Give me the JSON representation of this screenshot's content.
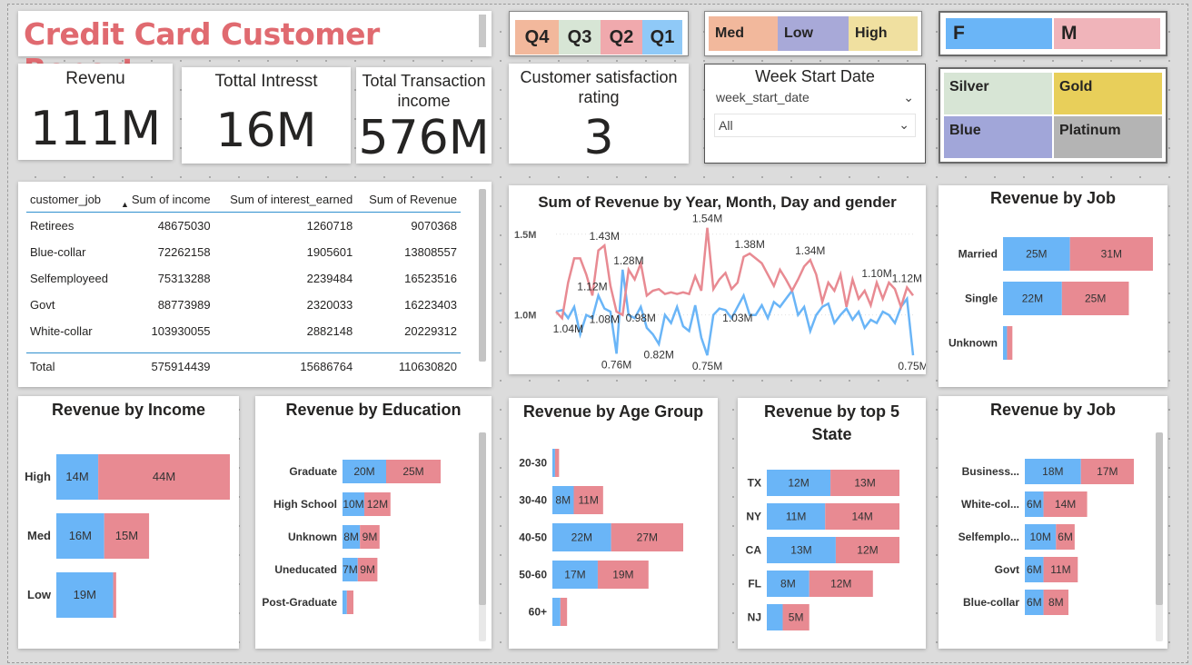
{
  "report": {
    "title": "Credit Card Customer Report"
  },
  "kpis": {
    "revenue": {
      "label": "Revenu",
      "value": "111M"
    },
    "interest": {
      "label": "Tottal Intresst",
      "value": "16M"
    },
    "transaction": {
      "label": "Total Transaction income",
      "value": "576M"
    },
    "satisfaction": {
      "label": "Customer satisfaction rating",
      "value": "3"
    }
  },
  "slicers": {
    "quarter": [
      {
        "label": "Q4",
        "color": "#f2b89c"
      },
      {
        "label": "Q3",
        "color": "#d7e5d5"
      },
      {
        "label": "Q2",
        "color": "#f0a9ad"
      },
      {
        "label": "Q1",
        "color": "#8fc9f7"
      }
    ],
    "risk": [
      {
        "label": "Med",
        "color": "#f2b89c"
      },
      {
        "label": "Low",
        "color": "#a8a9d8"
      },
      {
        "label": "High",
        "color": "#f0e0a0"
      }
    ],
    "gender": [
      {
        "label": "F",
        "color": "#6ab5f7"
      },
      {
        "label": "M",
        "color": "#f0b4ba"
      }
    ],
    "week": {
      "title": "Week Start Date",
      "field": "week_start_date",
      "selected": "All"
    },
    "card_category": [
      {
        "label": "Silver",
        "color": "#d7e5d5"
      },
      {
        "label": "Gold",
        "color": "#e8cf5a"
      },
      {
        "label": "Blue",
        "color": "#a1a6d9"
      },
      {
        "label": "Platinum",
        "color": "#b4b4b4"
      }
    ]
  },
  "matrix": {
    "columns": [
      "customer_job",
      "Sum of income",
      "Sum of interest_earned",
      "Sum of Revenue"
    ],
    "rows": [
      [
        "Retirees",
        "48675030",
        "1260718",
        "9070368"
      ],
      [
        "Blue-collar",
        "72262158",
        "1905601",
        "13808557"
      ],
      [
        "Selfemployeed",
        "75313288",
        "2239484",
        "16523516"
      ],
      [
        "Govt",
        "88773989",
        "2320033",
        "16223403"
      ],
      [
        "White-collar",
        "103930055",
        "2882148",
        "20229312"
      ]
    ],
    "total": [
      "Total",
      "575914439",
      "15686764",
      "110630820"
    ]
  },
  "colors": {
    "female": "#6ab5f7",
    "male": "#e88a92"
  },
  "charts": {
    "line": {
      "title": "Sum of Revenue by Year, Month, Day and gender",
      "yticks": [
        "1.5M",
        "1.0M"
      ]
    },
    "job_marital": {
      "title": "Revenue by Job"
    },
    "income": {
      "title": "Revenue by Income"
    },
    "education": {
      "title": "Revenue by Education"
    },
    "age": {
      "title": "Revenue by Age Group"
    },
    "state": {
      "title": "Revenue by top 5 State"
    },
    "job": {
      "title": "Revenue by Job"
    }
  },
  "chart_data": [
    {
      "type": "line",
      "title": "Sum of Revenue by Year, Month, Day and gender",
      "y_ticks": [
        1.0,
        1.5
      ],
      "ylim": [
        0.7,
        1.6
      ],
      "series": [
        {
          "name": "F",
          "values": [
            1.02,
            1.03,
            0.98,
            1.05,
            0.88,
            1.0,
            0.98,
            1.12,
            1.04,
            1.02,
            0.76,
            1.28,
            1.0,
            0.98,
            1.05,
            0.92,
            0.88,
            0.82,
            1.0,
            0.95,
            1.05,
            0.93,
            0.9,
            1.06,
            0.86,
            0.75,
            1.0,
            1.04,
            1.03,
            0.98,
            1.05,
            1.12,
            1.0,
            1.0,
            1.06,
            0.98,
            1.08,
            1.05,
            1.1,
            1.15,
            1.0,
            1.05,
            0.9,
            1.0,
            1.05,
            1.07,
            0.95,
            1.0,
            1.04,
            0.97,
            1.02,
            0.92,
            0.97,
            0.95,
            1.02,
            1.0,
            0.95,
            1.05,
            1.1,
            0.75
          ],
          "labels": [
            {
              "i": 2,
              "t": "1.04M"
            },
            {
              "i": 8,
              "t": "1.08M"
            },
            {
              "i": 10,
              "t": "0.76M"
            },
            {
              "i": 14,
              "t": "0.98M"
            },
            {
              "i": 17,
              "t": "0.82M"
            },
            {
              "i": 25,
              "t": "0.75M"
            },
            {
              "i": 30,
              "t": "1.03M"
            },
            {
              "i": 59,
              "t": "0.75M"
            }
          ]
        },
        {
          "name": "M",
          "values": [
            1.02,
            0.98,
            1.2,
            1.35,
            1.35,
            1.25,
            1.12,
            1.4,
            1.43,
            1.18,
            1.02,
            1.0,
            1.28,
            1.22,
            1.32,
            1.12,
            1.15,
            1.16,
            1.13,
            1.14,
            1.13,
            1.14,
            1.13,
            1.24,
            1.15,
            1.54,
            1.16,
            1.22,
            1.26,
            1.16,
            1.2,
            1.36,
            1.38,
            1.35,
            1.32,
            1.25,
            1.18,
            1.28,
            1.22,
            1.15,
            1.22,
            1.3,
            1.34,
            1.25,
            1.08,
            1.2,
            1.15,
            1.25,
            1.05,
            1.22,
            1.1,
            1.15,
            1.06,
            1.2,
            1.1,
            1.2,
            1.16,
            1.05,
            1.17,
            1.12
          ],
          "labels": [
            {
              "i": 6,
              "t": "1.12M"
            },
            {
              "i": 8,
              "t": "1.43M"
            },
            {
              "i": 12,
              "t": "1.28M"
            },
            {
              "i": 25,
              "t": "1.54M"
            },
            {
              "i": 32,
              "t": "1.38M"
            },
            {
              "i": 42,
              "t": "1.34M"
            },
            {
              "i": 53,
              "t": "1.10M"
            },
            {
              "i": 58,
              "t": "1.12M"
            }
          ]
        }
      ]
    },
    {
      "type": "bar",
      "title": "Revenue by Job",
      "orientation": "horizontal",
      "stacked": true,
      "categories": [
        "Married",
        "Single",
        "Unknown"
      ],
      "series": [
        {
          "name": "F",
          "values": [
            25,
            22,
            1.5
          ],
          "labels": [
            "25M",
            "22M",
            ""
          ]
        },
        {
          "name": "M",
          "values": [
            31,
            25,
            2
          ],
          "labels": [
            "31M",
            "25M",
            ""
          ]
        }
      ],
      "unit": "M"
    },
    {
      "type": "bar",
      "title": "Revenue by Income",
      "orientation": "horizontal",
      "stacked": true,
      "categories": [
        "High",
        "Med",
        "Low"
      ],
      "series": [
        {
          "name": "F",
          "values": [
            14,
            16,
            19
          ],
          "labels": [
            "14M",
            "16M",
            "19M"
          ]
        },
        {
          "name": "M",
          "values": [
            44,
            15,
            1
          ],
          "labels": [
            "44M",
            "15M",
            ""
          ]
        }
      ],
      "unit": "M"
    },
    {
      "type": "bar",
      "title": "Revenue by Education",
      "orientation": "horizontal",
      "stacked": true,
      "categories": [
        "Graduate",
        "High School",
        "Unknown",
        "Uneducated",
        "Post-Graduate"
      ],
      "series": [
        {
          "name": "F",
          "values": [
            20,
            10,
            8,
            7,
            2
          ],
          "labels": [
            "20M",
            "10M",
            "8M",
            "7M",
            ""
          ]
        },
        {
          "name": "M",
          "values": [
            25,
            12,
            9,
            9,
            3
          ],
          "labels": [
            "25M",
            "12M",
            "9M",
            "9M",
            ""
          ]
        }
      ],
      "unit": "M"
    },
    {
      "type": "bar",
      "title": "Revenue by Age Group",
      "orientation": "horizontal",
      "stacked": true,
      "categories": [
        "20-30",
        "30-40",
        "40-50",
        "50-60",
        "60+"
      ],
      "series": [
        {
          "name": "F",
          "values": [
            1,
            8,
            22,
            17,
            3
          ],
          "labels": [
            "",
            "8M",
            "22M",
            "17M",
            ""
          ]
        },
        {
          "name": "M",
          "values": [
            1.5,
            11,
            27,
            19,
            2.5
          ],
          "labels": [
            "",
            "11M",
            "27M",
            "19M",
            ""
          ]
        }
      ],
      "unit": "M"
    },
    {
      "type": "bar",
      "title": "Revenue by top 5 State",
      "orientation": "horizontal",
      "stacked": true,
      "categories": [
        "TX",
        "NY",
        "CA",
        "FL",
        "NJ"
      ],
      "series": [
        {
          "name": "F",
          "values": [
            12,
            11,
            13,
            8,
            3
          ],
          "labels": [
            "12M",
            "11M",
            "13M",
            "8M",
            ""
          ]
        },
        {
          "name": "M",
          "values": [
            13,
            14,
            12,
            12,
            5
          ],
          "labels": [
            "13M",
            "14M",
            "12M",
            "12M",
            "5M"
          ]
        }
      ],
      "unit": "M"
    },
    {
      "type": "bar",
      "title": "Revenue by Job",
      "orientation": "horizontal",
      "stacked": true,
      "categories": [
        "Business...",
        "White-col...",
        "Selfemplo...",
        "Govt",
        "Blue-collar"
      ],
      "series": [
        {
          "name": "F",
          "values": [
            18,
            6,
            10,
            6,
            6
          ],
          "labels": [
            "18M",
            "6M",
            "10M",
            "6M",
            "6M"
          ]
        },
        {
          "name": "M",
          "values": [
            17,
            14,
            6,
            11,
            8
          ],
          "labels": [
            "17M",
            "14M",
            "6M",
            "11M",
            "8M"
          ]
        }
      ],
      "unit": "M"
    }
  ]
}
